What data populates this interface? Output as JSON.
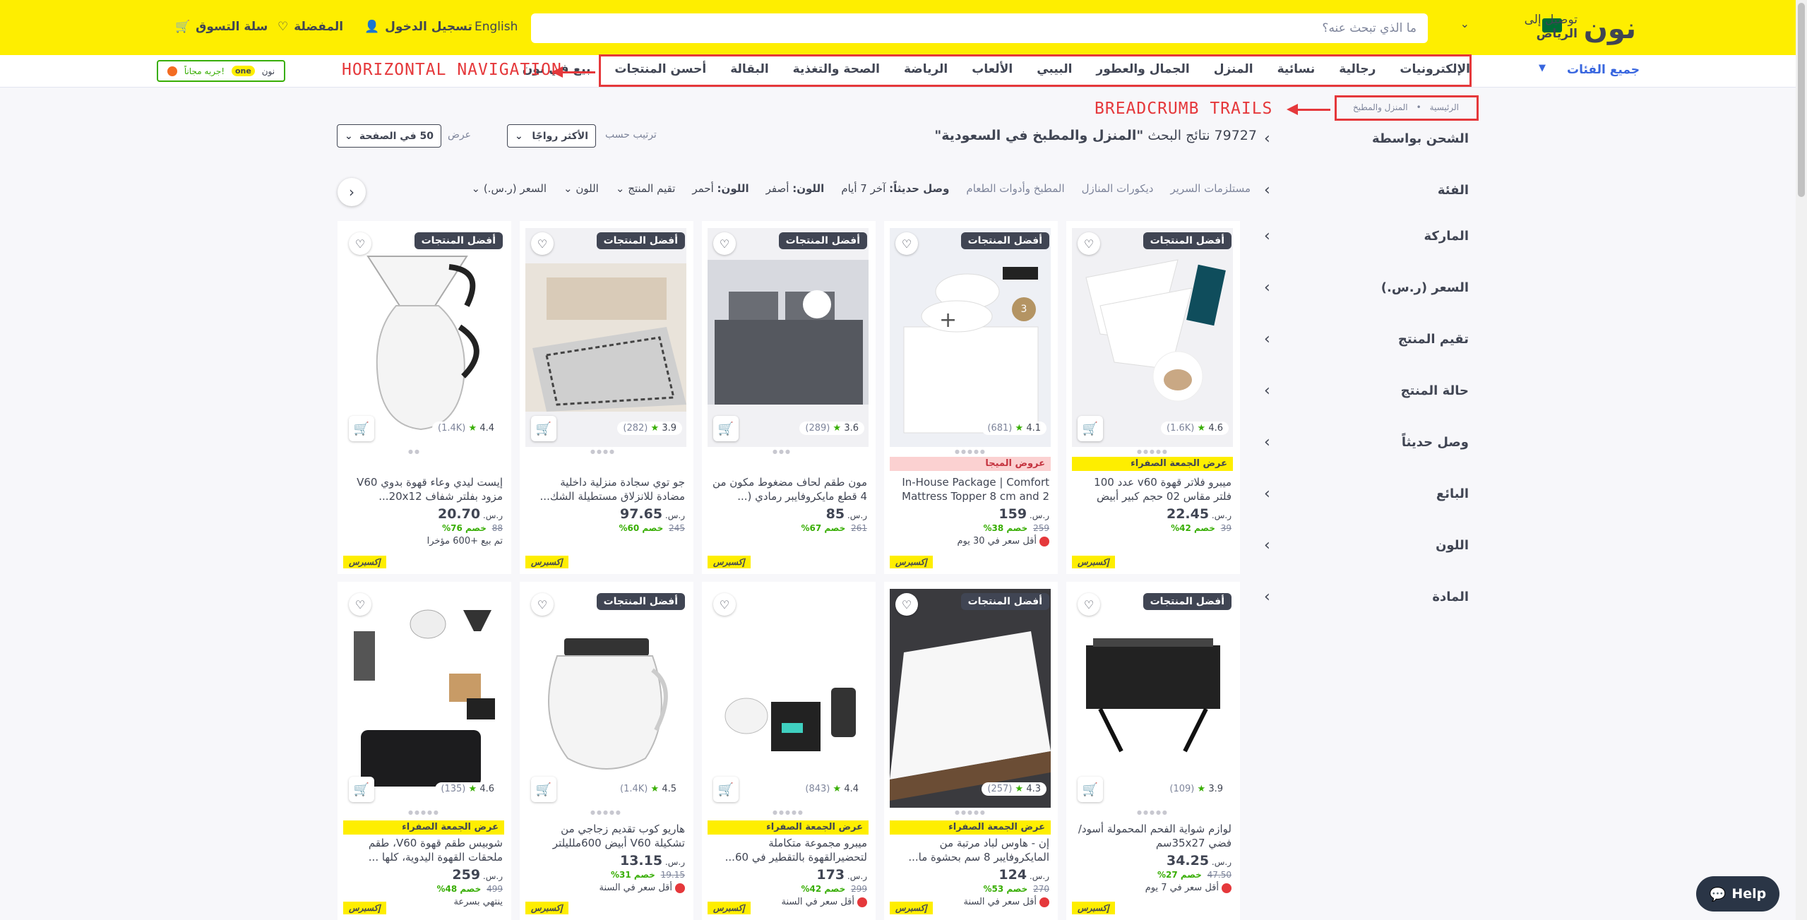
{
  "header": {
    "logo": "نون",
    "deliver_label": "توصيل إلى",
    "deliver_city": "الرياض",
    "search_placeholder": "ما الذي تبحث عنه؟",
    "language": "English",
    "login": "تسجيل الدخول",
    "favorites": "المفضلة",
    "cart": "سلة التسوق"
  },
  "nav": {
    "all_categories": "جميع الفئات",
    "items": [
      "الإلكترونيات",
      "رجالية",
      "نسائية",
      "المنزل",
      "الجمال والعطور",
      "البيبي",
      "الألعاب",
      "الرياضة",
      "الصحة والتغذية",
      "البقالة",
      "أحسن المنتجات",
      "بيع في نون"
    ],
    "promo_text": "جربه مجاناً!",
    "promo_brand": "one",
    "promo_noon": "نون"
  },
  "annotations": {
    "nav": "HORIZONTAL NAVIGATION",
    "crumbs": "BREADCRUMB TRAILS"
  },
  "breadcrumb": [
    "الرئيسية",
    "المنزل والمطبخ"
  ],
  "results": {
    "count": "79727",
    "prefix": "نتائج البحث",
    "query": "\"المنزل والمطبخ في السعودية\""
  },
  "sort": {
    "label": "ترتيب حسب",
    "value": "الأكثر رواجًا",
    "view_label": "عرض",
    "view_value": "50 في الصفحة"
  },
  "sidebar": [
    "الشحن بواسطة",
    "الفئة",
    "الماركة",
    "السعر (ر.س.)",
    "تقيم المنتج",
    "حالة المنتج",
    "وصل حديثاً",
    "البائع",
    "اللون",
    "المادة"
  ],
  "filters": {
    "price": "السعر (ر.س.)",
    "color": "اللون",
    "rating": "تقيم المنتج",
    "color_red_label": "اللون:",
    "color_red": "أحمر",
    "color_yellow_label": "اللون:",
    "color_yellow": "أصفر",
    "arrived_label": "وصل حديثاً:",
    "arrived": "آخر 7 أيام",
    "kitchen": "المطبخ وأدوات الطعام",
    "decor": "ديكورات المنازل",
    "bedding": "مستلزمات السرير"
  },
  "products": [
    {
      "badge": "أفضل المنتجات",
      "rating": "4.6",
      "count": "(1.6K)",
      "tag": "عرض الجمعة الصفراء",
      "title": "ميبرو فلاتر قهوة v60 عدد 100 فلتر مقاس 02 حجم كبير أبيض",
      "price": "22.45",
      "old": "39",
      "off": "خصم 42%",
      "note": "",
      "currency": "ر.س."
    },
    {
      "badge": "أفضل المنتجات",
      "rating": "4.1",
      "count": "(681)",
      "tag": "عروض الميجا",
      "title": "In-House Package | Comfort Mattress Topper 8 cm and 2 H",
      "price": "159",
      "old": "259",
      "off": "خصم 38%",
      "note": "أقل سعر في 30 يوم",
      "currency": "ر.س."
    },
    {
      "badge": "أفضل المنتجات",
      "rating": "3.6",
      "count": "(289)",
      "tag": "",
      "title": "مون طقم لحاف مضغوط مكون من 4 قطع مايكروفايبر رمادي (...",
      "price": "85",
      "old": "261",
      "off": "خصم 67%",
      "note": "",
      "currency": "ر.س."
    },
    {
      "badge": "أفضل المنتجات",
      "rating": "3.9",
      "count": "(282)",
      "tag": "",
      "title": "جو توي سجادة منزلية داخلية مضادة للانزلاق مستطيلة الشك...",
      "price": "97.65",
      "old": "245",
      "off": "خصم 60%",
      "note": "",
      "currency": "ر.س."
    },
    {
      "badge": "أفضل المنتجات",
      "rating": "4.4",
      "count": "(1.4K)",
      "tag": "",
      "title": "إيست ليدي وعاء قهوة بدوي V60 مزود بفلتر شفاف 20x12...",
      "price": "20.70",
      "old": "88",
      "off": "خصم 76%",
      "note": "تم بيع +600 مؤخرا",
      "currency": "ر.س."
    },
    {
      "badge": "أفضل المنتجات",
      "rating": "3.9",
      "count": "(109)",
      "tag": "",
      "title": "لوازم شواية الفحم المحمولة أسود/فضي 35x27سم",
      "price": "34.25",
      "old": "47.50",
      "off": "خصم 27%",
      "note": "أقل سعر في 7 يوم",
      "currency": "ر.س."
    },
    {
      "badge": "أفضل المنتجات",
      "rating": "4.3",
      "count": "(257)",
      "tag": "عرض الجمعة الصفراء",
      "title": "إن - هاوس لباد مرتبة من المايكروفايبر 8 سم بحشوة ما...",
      "price": "124",
      "old": "270",
      "off": "خصم 53%",
      "note": "أقل سعر في السنة",
      "currency": "ر.س."
    },
    {
      "badge": "",
      "rating": "4.4",
      "count": "(843)",
      "tag": "عرض الجمعة الصفراء",
      "title": "ميبرو مجموعة متكاملة لتحضيرالقهوة بالتقطير في 60...",
      "price": "173",
      "old": "299",
      "off": "خصم 42%",
      "note": "أقل سعر في السنة",
      "currency": "ر.س."
    },
    {
      "badge": "أفضل المنتجات",
      "rating": "4.5",
      "count": "(1.4K)",
      "tag": "",
      "title": "هاريو كوب تقديم زجاجي من تشكيلة V60 أبيض 600مللیلتر",
      "price": "13.15",
      "old": "19.15",
      "off": "خصم 31%",
      "note": "أقل سعر في السنة",
      "currency": "ر.س."
    },
    {
      "badge": "",
      "rating": "4.6",
      "count": "(135)",
      "tag": "عرض الجمعة الصفراء",
      "title": "شوبيس طقم قهوة V60، طقم ملحقات القهوة اليدوية، كلها ...",
      "price": "259",
      "old": "499",
      "off": "خصم 48%",
      "note": "ينتهي بسرعة",
      "currency": "ر.س."
    }
  ],
  "express": "إكسبرس",
  "help": "Help"
}
